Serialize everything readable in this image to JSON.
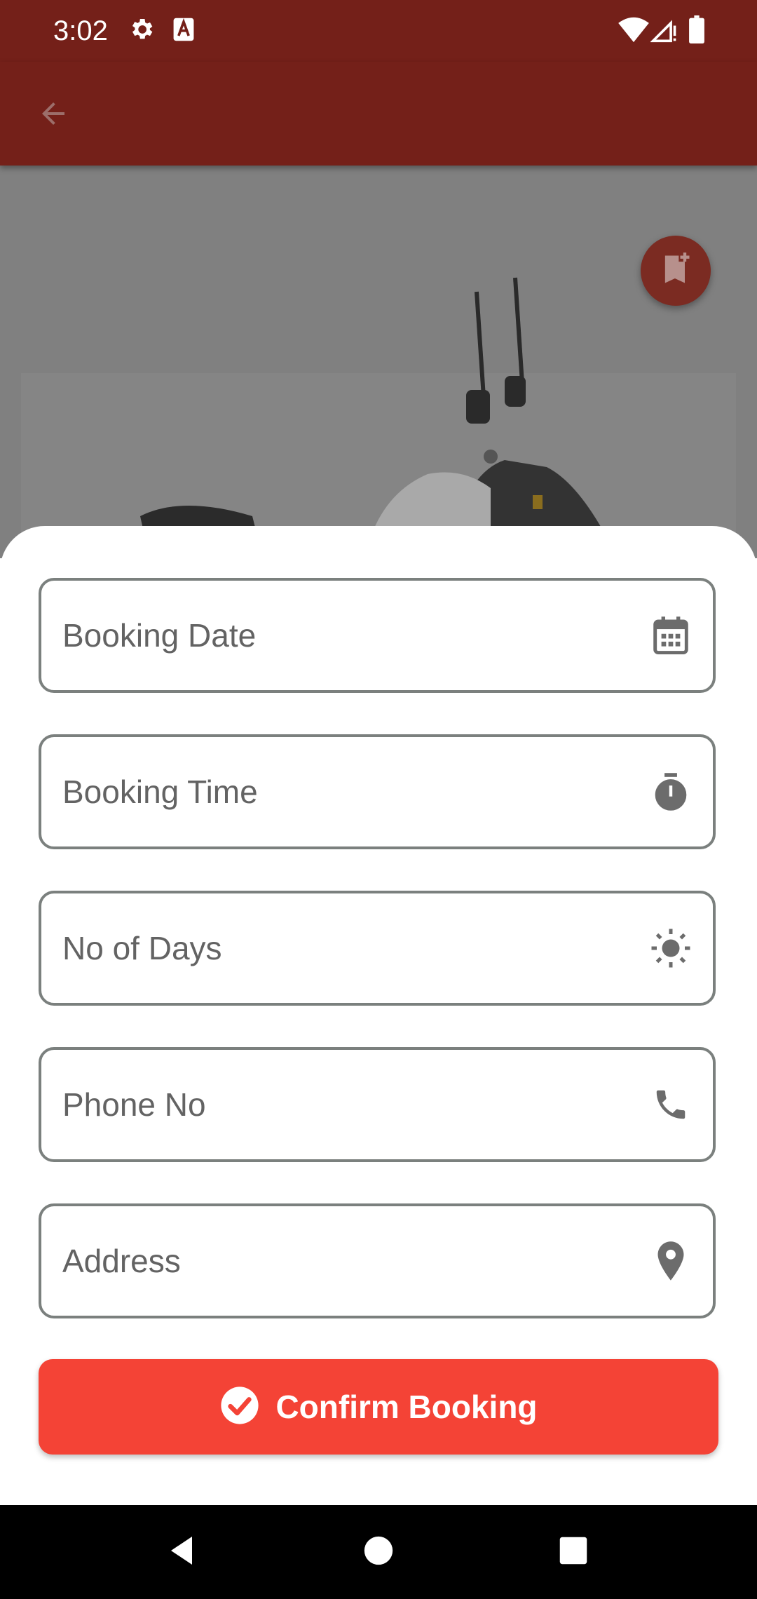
{
  "status_bar": {
    "time": "3:02",
    "icons": [
      "settings-icon",
      "text-a-icon",
      "wifi-icon",
      "cell-signal-icon",
      "battery-icon"
    ]
  },
  "app_bar": {
    "back_icon": "arrow-back-icon",
    "color": "#742019"
  },
  "hero": {
    "bookmark_icon": "bookmark-add-icon"
  },
  "form": {
    "fields": [
      {
        "label": "Booking Date",
        "icon": "calendar-icon"
      },
      {
        "label": "Booking Time",
        "icon": "timer-icon"
      },
      {
        "label": "No of Days",
        "icon": "sun-icon"
      },
      {
        "label": "Phone No",
        "icon": "phone-icon"
      },
      {
        "label": "Address",
        "icon": "location-pin-icon"
      }
    ],
    "confirm_label": "Confirm Booking",
    "confirm_icon": "check-circle-icon"
  },
  "colors": {
    "primary": "#742019",
    "button": "#f44336",
    "field_border": "#7b807e",
    "field_text": "#636363"
  },
  "nav_bar": {
    "buttons": [
      "back-triangle-icon",
      "home-circle-icon",
      "recents-square-icon"
    ]
  }
}
